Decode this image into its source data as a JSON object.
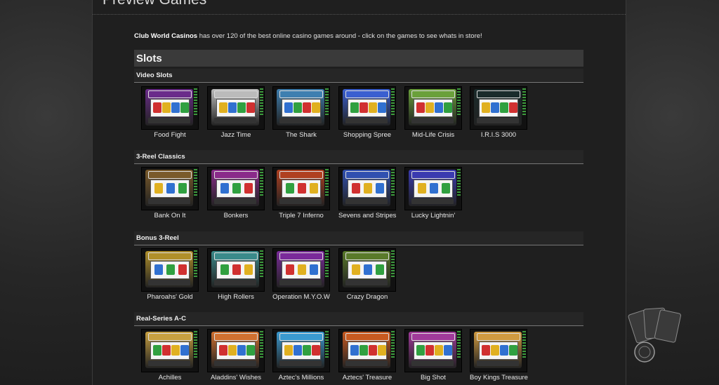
{
  "page": {
    "title": "Preview Games"
  },
  "intro": {
    "brand": "Club World Casinos",
    "text": " has over 120 of the best online casino games around - click on the games to see whats in store!"
  },
  "section": {
    "label": "Slots"
  },
  "categories": [
    {
      "label": "Video Slots",
      "games": [
        "Food Fight",
        "Jazz Time",
        "The Shark",
        "Shopping Spree",
        "Mid-Life Crisis",
        "I.R.I.S 3000"
      ],
      "colors": [
        "#6a2b8a",
        "#bbbbbb",
        "#3e7fb0",
        "#3a5fd0",
        "#6aa03a",
        "#1a2b2b"
      ]
    },
    {
      "label": "3-Reel Classics",
      "games": [
        "Bank On It",
        "Bonkers",
        "Triple 7 Inferno",
        "Sevens and Stripes",
        "Lucky Lightnin'"
      ],
      "colors": [
        "#7a5a2a",
        "#8a2a8a",
        "#b04020",
        "#3050b0",
        "#3a3ab0"
      ]
    },
    {
      "label": "Bonus 3-Reel",
      "games": [
        "Pharoahs' Gold",
        "High Rollers",
        "Operation M.Y.O.W",
        "Crazy Dragon"
      ],
      "colors": [
        "#b0902a",
        "#3a8a8a",
        "#7a2a9a",
        "#5a7a2a"
      ]
    },
    {
      "label": "Real-Series A-C",
      "games": [
        "Achilles",
        "Aladdins' Wishes",
        "Aztec's Millions",
        "Aztecs' Treasure",
        "Big Shot",
        "Boy Kings Treasure"
      ],
      "colors": [
        "#c8a040",
        "#d07030",
        "#3a9ad0",
        "#c85a20",
        "#a03a9a",
        "#d09a40"
      ]
    }
  ]
}
